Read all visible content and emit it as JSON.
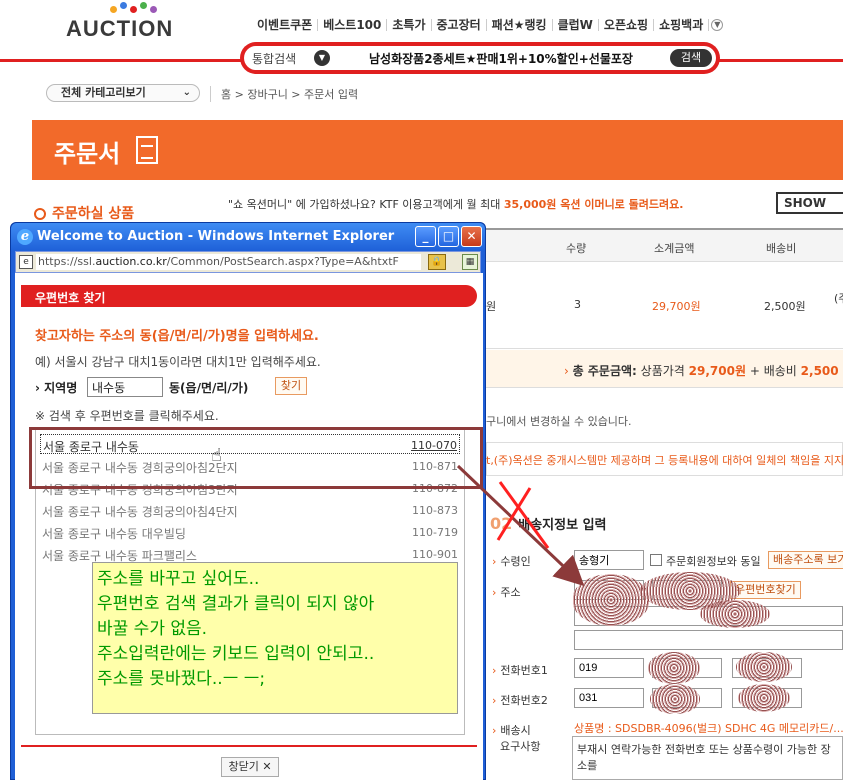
{
  "auction": {
    "logo_text": "AUCTION",
    "top_nav": [
      "이벤트쿠폰",
      "베스트100",
      "초특가",
      "중고장터",
      "패션★랭킹",
      "클럽W",
      "오픈쇼핑",
      "쇼핑백과"
    ],
    "search": {
      "scope": "통합검색",
      "query": "남성화장품2종세트★판매1위+10%할인+선물포장",
      "button": "검색"
    },
    "category_select": "전체 카테고리보기",
    "breadcrumb": "홈 > 장바구니 > 주문서 입력",
    "order_title": "주문서",
    "order_items_heading": "주문하실 상품",
    "promo": {
      "part1": "\"쇼 옥션머니\" 에 가입하셨나요? KTF 이용고객에게 월 최대 ",
      "amount": "35,000원 옥션 이머니로 돌려드려요.",
      "show_button": "SHOW"
    },
    "table": {
      "headers": [
        "수량",
        "소계금액",
        "배송비"
      ],
      "row": {
        "price_suffix": "원",
        "qty": "3",
        "subtotal": "29,700원",
        "shipping": "2,500원",
        "extra": "(주"
      }
    },
    "total": {
      "label": "총 주문금액:",
      "goods_label": "상품가격",
      "goods_amount": "29,700원",
      "plus_shipping": "+ 배송비",
      "shipping_amount": "2,500"
    },
    "note_cart": "구니에서 변경하실 수 있습니다.",
    "note_warning": "t,(주)옥션은 중개시스템만 제공하며 그 등록내용에 대하여 일체의 책임을 지지 않",
    "shipping": {
      "number": "02",
      "heading": "배송지정보 입력",
      "recipient_label": "수령인",
      "recipient_value": "송형기",
      "same_as_member": "주문회원정보와 동일",
      "address_book_button": "배송주소록 보기",
      "address_label": "주소",
      "zip_search_button": "우편번호찾기",
      "phone1_label": "전화번호1",
      "phone1_value": "019",
      "phone2_label": "전화번호2",
      "phone2_value": "031",
      "request_label_1": "배송시",
      "request_label_2": "요구사항",
      "request_hint": "상품명 : SDSDBR-4096(벌크) SDHC 4G 메모리카드/...",
      "request_text": "부재시 연락가능한 전화번호 또는 상품수령이 가능한 장소를"
    }
  },
  "popup": {
    "window_title": "Welcome to Auction - Windows Internet Explorer",
    "url_prefix": "https://ssl.",
    "url_domain": "auction.co.kr",
    "url_rest": "/Common/PostSearch.aspx?Type=A&htxtF",
    "header": "우편번호 찾기",
    "instruction": "찾고자하는 주소의 동(읍/면/리/가)명을 입력하세요.",
    "example": "예) 서울시 강남구 대치1동이라면 대치1만 입력해주세요.",
    "region_label": "지역명",
    "region_value": "내수동",
    "region_suffix": "동(읍/면/리/가)",
    "find_button": "찾기",
    "hint": "※ 검색 후 우편번호를 클릭해주세요.",
    "results": [
      {
        "address": "서울 종로구 내수동",
        "zip": "110-070"
      },
      {
        "address": "서울 종로구 내수동 경희궁의아침2단지",
        "zip": "110-871"
      },
      {
        "address": "서울 종로구 내수동 경희궁의아침3단지",
        "zip": "110-872"
      },
      {
        "address": "서울 종로구 내수동 경희궁의아침4단지",
        "zip": "110-873"
      },
      {
        "address": "서울 종로구 내수동 대우빌딩",
        "zip": "110-719"
      },
      {
        "address": "서울 종로구 내수동 파크팰리스",
        "zip": "110-901"
      }
    ],
    "close_button": "창닫기"
  },
  "annotation": [
    "주소를 바꾸고 싶어도..",
    "우편번호 검색 결과가 클릭이 되지 않아",
    "바꿀 수가 없음.",
    "주소입력란에는 키보드 입력이 안되고..",
    "주소를 못바꿨다..ㅡ ㅡ;"
  ],
  "colors": {
    "accent": "#e02020",
    "orange": "#f26a2a",
    "note_green": "#009900",
    "note_bg": "#ffffaa"
  }
}
